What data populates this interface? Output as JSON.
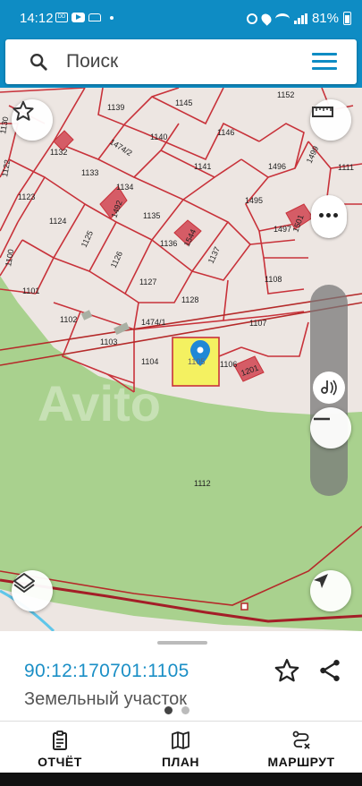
{
  "status_bar": {
    "time": "14:12",
    "battery": "81%"
  },
  "search": {
    "placeholder": "Поиск"
  },
  "map": {
    "watermark": "Avito",
    "colors": {
      "parcel_border": "#c8323a",
      "land_green": "#a9d18e",
      "background": "#ede6e2",
      "selected_fill": "#f5f24a",
      "pin": "#1f88d6"
    },
    "parcels": [
      {
        "label": "1152"
      },
      {
        "label": "1145"
      },
      {
        "label": "1139"
      },
      {
        "label": "1146"
      },
      {
        "label": "1140"
      },
      {
        "label": "1474/2"
      },
      {
        "label": "1132"
      },
      {
        "label": "1141"
      },
      {
        "label": "1496"
      },
      {
        "label": "1499"
      },
      {
        "label": "1111"
      },
      {
        "label": "1130"
      },
      {
        "label": "1122"
      },
      {
        "label": "1133"
      },
      {
        "label": "1134"
      },
      {
        "label": "1495"
      },
      {
        "label": "1123"
      },
      {
        "label": "1135"
      },
      {
        "label": "1124"
      },
      {
        "label": "1497"
      },
      {
        "label": "1501"
      },
      {
        "label": "1136"
      },
      {
        "label": "1544"
      },
      {
        "label": "1125"
      },
      {
        "label": "1137"
      },
      {
        "label": "1126"
      },
      {
        "label": "1100"
      },
      {
        "label": "1108"
      },
      {
        "label": "1127"
      },
      {
        "label": "1101"
      },
      {
        "label": "1128"
      },
      {
        "label": "1102"
      },
      {
        "label": "1474/1"
      },
      {
        "label": "1107"
      },
      {
        "label": "1103"
      },
      {
        "label": "1104"
      },
      {
        "label": "1105"
      },
      {
        "label": "1106"
      },
      {
        "label": "1201"
      },
      {
        "label": "1112"
      },
      {
        "label": "1492"
      }
    ]
  },
  "info_sheet": {
    "cadastral_number": "90:12:170701:1105",
    "parcel_type": "Земельный участок",
    "page_dots": [
      "active",
      "inactive"
    ]
  },
  "bottom_nav": {
    "items": [
      {
        "label": "ОТЧЁТ",
        "icon": "report-icon"
      },
      {
        "label": "ПЛАН",
        "icon": "map-icon"
      },
      {
        "label": "МАРШРУТ",
        "icon": "route-icon"
      }
    ]
  }
}
